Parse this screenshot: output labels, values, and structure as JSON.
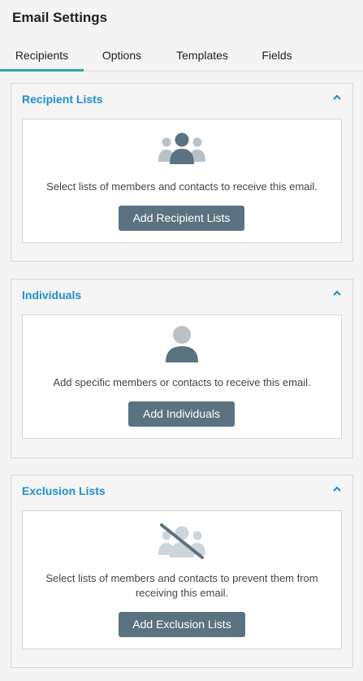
{
  "header": {
    "title": "Email Settings"
  },
  "tabs": [
    {
      "label": "Recipients",
      "active": true
    },
    {
      "label": "Options",
      "active": false
    },
    {
      "label": "Templates",
      "active": false
    },
    {
      "label": "Fields",
      "active": false
    }
  ],
  "recipient_lists": {
    "title": "Recipient Lists",
    "icon": "group-icon",
    "description": "Select lists of members and contacts to receive this email.",
    "button": "Add Recipient Lists"
  },
  "individuals": {
    "title": "Individuals",
    "icon": "person-icon",
    "description": "Add specific members or contacts to receive this email.",
    "button": "Add Individuals"
  },
  "exclusion_lists": {
    "title": "Exclusion Lists",
    "icon": "group-excluded-icon",
    "description": "Select lists of members and contacts to prevent them from receiving this email.",
    "button": "Add Exclusion Lists"
  },
  "colors": {
    "accent": "#1f8fcf",
    "tab_underline": "#2aa5a0",
    "button_bg": "#5b7280",
    "icon_dark": "#5b7280",
    "icon_light": "#b8c1c8"
  }
}
